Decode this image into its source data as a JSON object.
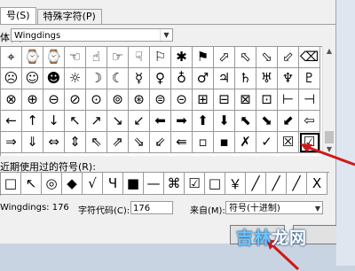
{
  "dialog": {
    "tabs": [
      {
        "label": "号(S)",
        "active": true
      },
      {
        "label": "特殊字符(P)",
        "active": false
      }
    ],
    "font": {
      "label": "体(F):",
      "value": "Wingdings"
    },
    "symbol_rows": [
      [
        "⌖",
        "⌚",
        "⌚",
        "☜",
        "☝",
        "☞",
        "☟",
        "⚐",
        "✱",
        "⚑",
        "⬀",
        "⬁",
        "⬂",
        "⬃",
        "⌫"
      ],
      [
        "☹",
        "☺",
        "☻",
        "☼",
        "☽",
        "☾",
        "☿",
        "♀",
        "♁",
        "♂",
        "♃",
        "♄",
        "♅",
        "♆",
        "♇"
      ],
      [
        "⊗",
        "⊕",
        "⊖",
        "⊘",
        "⊙",
        "⊚",
        "⊛",
        "⊜",
        "⊝",
        "⊞",
        "⊟",
        "⊠",
        "⊡",
        "⊢",
        "⊣"
      ],
      [
        "←",
        "↑",
        "↓",
        "↖",
        "↗",
        "↘",
        "↙",
        "⬅",
        "➡",
        "⬆",
        "⬇",
        "⬉",
        "⬊",
        "⬋",
        "⇦"
      ],
      [
        "⇒",
        "⇓",
        "⇔",
        "⇕",
        "⇖",
        "⇗",
        "⇘",
        "⇙",
        "⇚",
        "▫",
        "▪",
        "✗",
        "✓",
        "☒",
        "☑"
      ]
    ],
    "recent_label": "近期使用过的符号(R):",
    "recent_symbols": [
      "□",
      "↖",
      "◎",
      "◆",
      "√",
      "Ч",
      "■",
      "—",
      "⌘",
      "☑",
      "□",
      "￥",
      "╱",
      "╱",
      "╱",
      "Ⅹ"
    ],
    "char_name": "Wingdings: 176",
    "code_label": "字符代码(C):",
    "code_value": "176",
    "from_label": "来自(M):",
    "from_value": "符号(十进制)",
    "watermark": "吉林龙网"
  }
}
